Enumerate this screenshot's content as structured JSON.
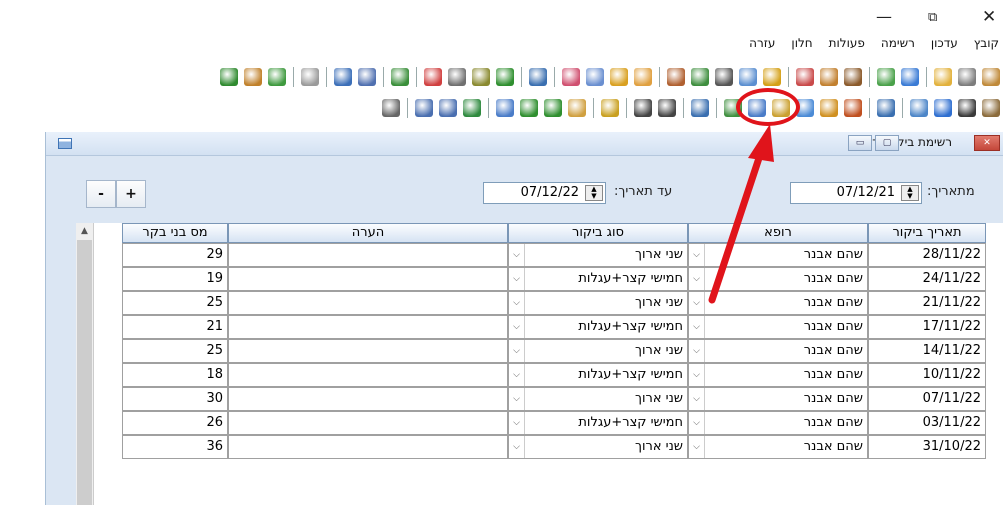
{
  "window_controls": {
    "minimize": "—",
    "maximize": "⧉",
    "close": "✕"
  },
  "menu": [
    "קובץ",
    "עדכון",
    "רשימה",
    "פעולות",
    "חלון",
    "עזרה"
  ],
  "toolbar_row1": {
    "icons": [
      {
        "name": "shovel-icon",
        "color": "#c08a3a"
      },
      {
        "name": "gear-icon",
        "color": "#7d7d7d"
      },
      {
        "name": "folder-icon",
        "color": "#e2b13c"
      },
      {
        "name": "sep"
      },
      {
        "name": "chart-icon",
        "color": "#3a7bd5"
      },
      {
        "name": "flask-icon",
        "color": "#4aa14a"
      },
      {
        "name": "sep"
      },
      {
        "name": "cow-icon",
        "color": "#8b5a2b"
      },
      {
        "name": "bag-icon",
        "color": "#c2802f"
      },
      {
        "name": "person-icon",
        "color": "#c94a4a"
      },
      {
        "name": "sep"
      },
      {
        "name": "scales-icon",
        "color": "#d4a017"
      },
      {
        "name": "syringe-icon",
        "color": "#5b8fd0"
      },
      {
        "name": "microscope-icon",
        "color": "#555"
      },
      {
        "name": "bottle-icon",
        "color": "#3e8e3e"
      },
      {
        "name": "brush-icon",
        "color": "#b06030"
      },
      {
        "name": "sep"
      },
      {
        "name": "pencil-icon",
        "color": "#e0a040"
      },
      {
        "name": "bucket-icon",
        "color": "#d9a020"
      },
      {
        "name": "people-icon",
        "color": "#6a8fd0"
      },
      {
        "name": "flower-icon",
        "color": "#d05070"
      },
      {
        "name": "sep"
      },
      {
        "name": "grid-icon",
        "color": "#3a6fb0"
      },
      {
        "name": "sep"
      },
      {
        "name": "clover-icon",
        "color": "#2f8f2f"
      },
      {
        "name": "checklist-icon",
        "color": "#8a8a30"
      },
      {
        "name": "robot-icon",
        "color": "#707070"
      },
      {
        "name": "ribbon-icon",
        "color": "#d04040"
      },
      {
        "name": "sep"
      },
      {
        "name": "tree-icon",
        "color": "#3a8f3a"
      },
      {
        "name": "sep"
      },
      {
        "name": "magnifier-icon",
        "color": "#5070b0"
      },
      {
        "name": "truck-icon",
        "color": "#3c6fb8"
      },
      {
        "name": "sep"
      },
      {
        "name": "document-icon",
        "color": "#9a9a9a"
      },
      {
        "name": "sep"
      },
      {
        "name": "person-green-icon",
        "color": "#3f9a3f"
      },
      {
        "name": "percent-icon",
        "color": "#c0802a"
      },
      {
        "name": "dollar-icon",
        "color": "#2f8a2f"
      }
    ]
  },
  "toolbar_row2": {
    "icons": [
      {
        "name": "gear-small-icon",
        "color": "#8b6b3b"
      },
      {
        "name": "eye-icon",
        "color": "#3a3a3a"
      },
      {
        "name": "foot-icon",
        "color": "#2f6fd0"
      },
      {
        "name": "search-doc-icon",
        "color": "#4d86c8"
      },
      {
        "name": "sep"
      },
      {
        "name": "card-icon",
        "color": "#3a6fb0"
      },
      {
        "name": "sep"
      },
      {
        "name": "dots-icon",
        "color": "#c05020"
      },
      {
        "name": "wheel-icon",
        "color": "#d09020"
      },
      {
        "name": "visit-report-icon",
        "color": "#4b8bd6"
      },
      {
        "name": "cash-icon",
        "color": "#caa030"
      },
      {
        "name": "people-group-icon",
        "color": "#4a7cc8"
      },
      {
        "name": "export-icon",
        "color": "#3f8f3f"
      },
      {
        "name": "sep"
      },
      {
        "name": "calc-icon",
        "color": "#3a6fb0"
      },
      {
        "name": "sep"
      },
      {
        "name": "grid-add-icon",
        "color": "#444"
      },
      {
        "name": "grid-edit-icon",
        "color": "#444"
      },
      {
        "name": "sep"
      },
      {
        "name": "arrow-back-icon",
        "color": "#c9a020"
      },
      {
        "name": "sep"
      },
      {
        "name": "wand-icon",
        "color": "#d0a040"
      },
      {
        "name": "filter-icon",
        "color": "#2f8f2f"
      },
      {
        "name": "filter-add-icon",
        "color": "#2f8f2f"
      },
      {
        "name": "sort-icon",
        "color": "#4a7cc8"
      },
      {
        "name": "sep"
      },
      {
        "name": "excel-icon",
        "color": "#2f8a3f"
      },
      {
        "name": "print-icon",
        "color": "#4a6fb0"
      },
      {
        "name": "print-preview-icon",
        "color": "#4a6fb0"
      },
      {
        "name": "sep"
      },
      {
        "name": "tree-view-icon",
        "color": "#666"
      }
    ]
  },
  "child_window": {
    "title": "רשימת ביקורי-רופא",
    "min_label": "▭",
    "max_label": "▢",
    "close_label": "✕"
  },
  "filters": {
    "from_label": "מתאריך:",
    "from_value": "07/12/21",
    "to_label": "עד תאריך:",
    "to_value": "07/12/22",
    "minus_label": "-",
    "plus_label": "+"
  },
  "grid": {
    "headers": {
      "visit_date": "תאריך ביקור",
      "doctor": "רופא",
      "visit_type": "סוג ביקור",
      "note": "הערה",
      "cattle_count": "מס בני בקר"
    },
    "rows": [
      {
        "date": "28/11/22",
        "doctor": "שהם אבנר",
        "type": "שני ארוך",
        "note": "",
        "count": "29"
      },
      {
        "date": "24/11/22",
        "doctor": "שהם אבנר",
        "type": "חמישי קצר+עגלות",
        "note": "",
        "count": "19"
      },
      {
        "date": "21/11/22",
        "doctor": "שהם אבנר",
        "type": "שני ארוך",
        "note": "",
        "count": "25"
      },
      {
        "date": "17/11/22",
        "doctor": "שהם אבנר",
        "type": "חמישי קצר+עגלות",
        "note": "",
        "count": "21"
      },
      {
        "date": "14/11/22",
        "doctor": "שהם אבנר",
        "type": "שני ארוך",
        "note": "",
        "count": "25"
      },
      {
        "date": "10/11/22",
        "doctor": "שהם אבנר",
        "type": "חמישי קצר+עגלות",
        "note": "",
        "count": "18"
      },
      {
        "date": "07/11/22",
        "doctor": "שהם אבנר",
        "type": "שני ארוך",
        "note": "",
        "count": "30"
      },
      {
        "date": "03/11/22",
        "doctor": "שהם אבנר",
        "type": "חמישי קצר+עגלות",
        "note": "",
        "count": "26"
      },
      {
        "date": "31/10/22",
        "doctor": "שהם אבנר",
        "type": "שני ארוך",
        "note": "",
        "count": "36"
      }
    ]
  },
  "annotation": {
    "color": "#e0141b"
  }
}
